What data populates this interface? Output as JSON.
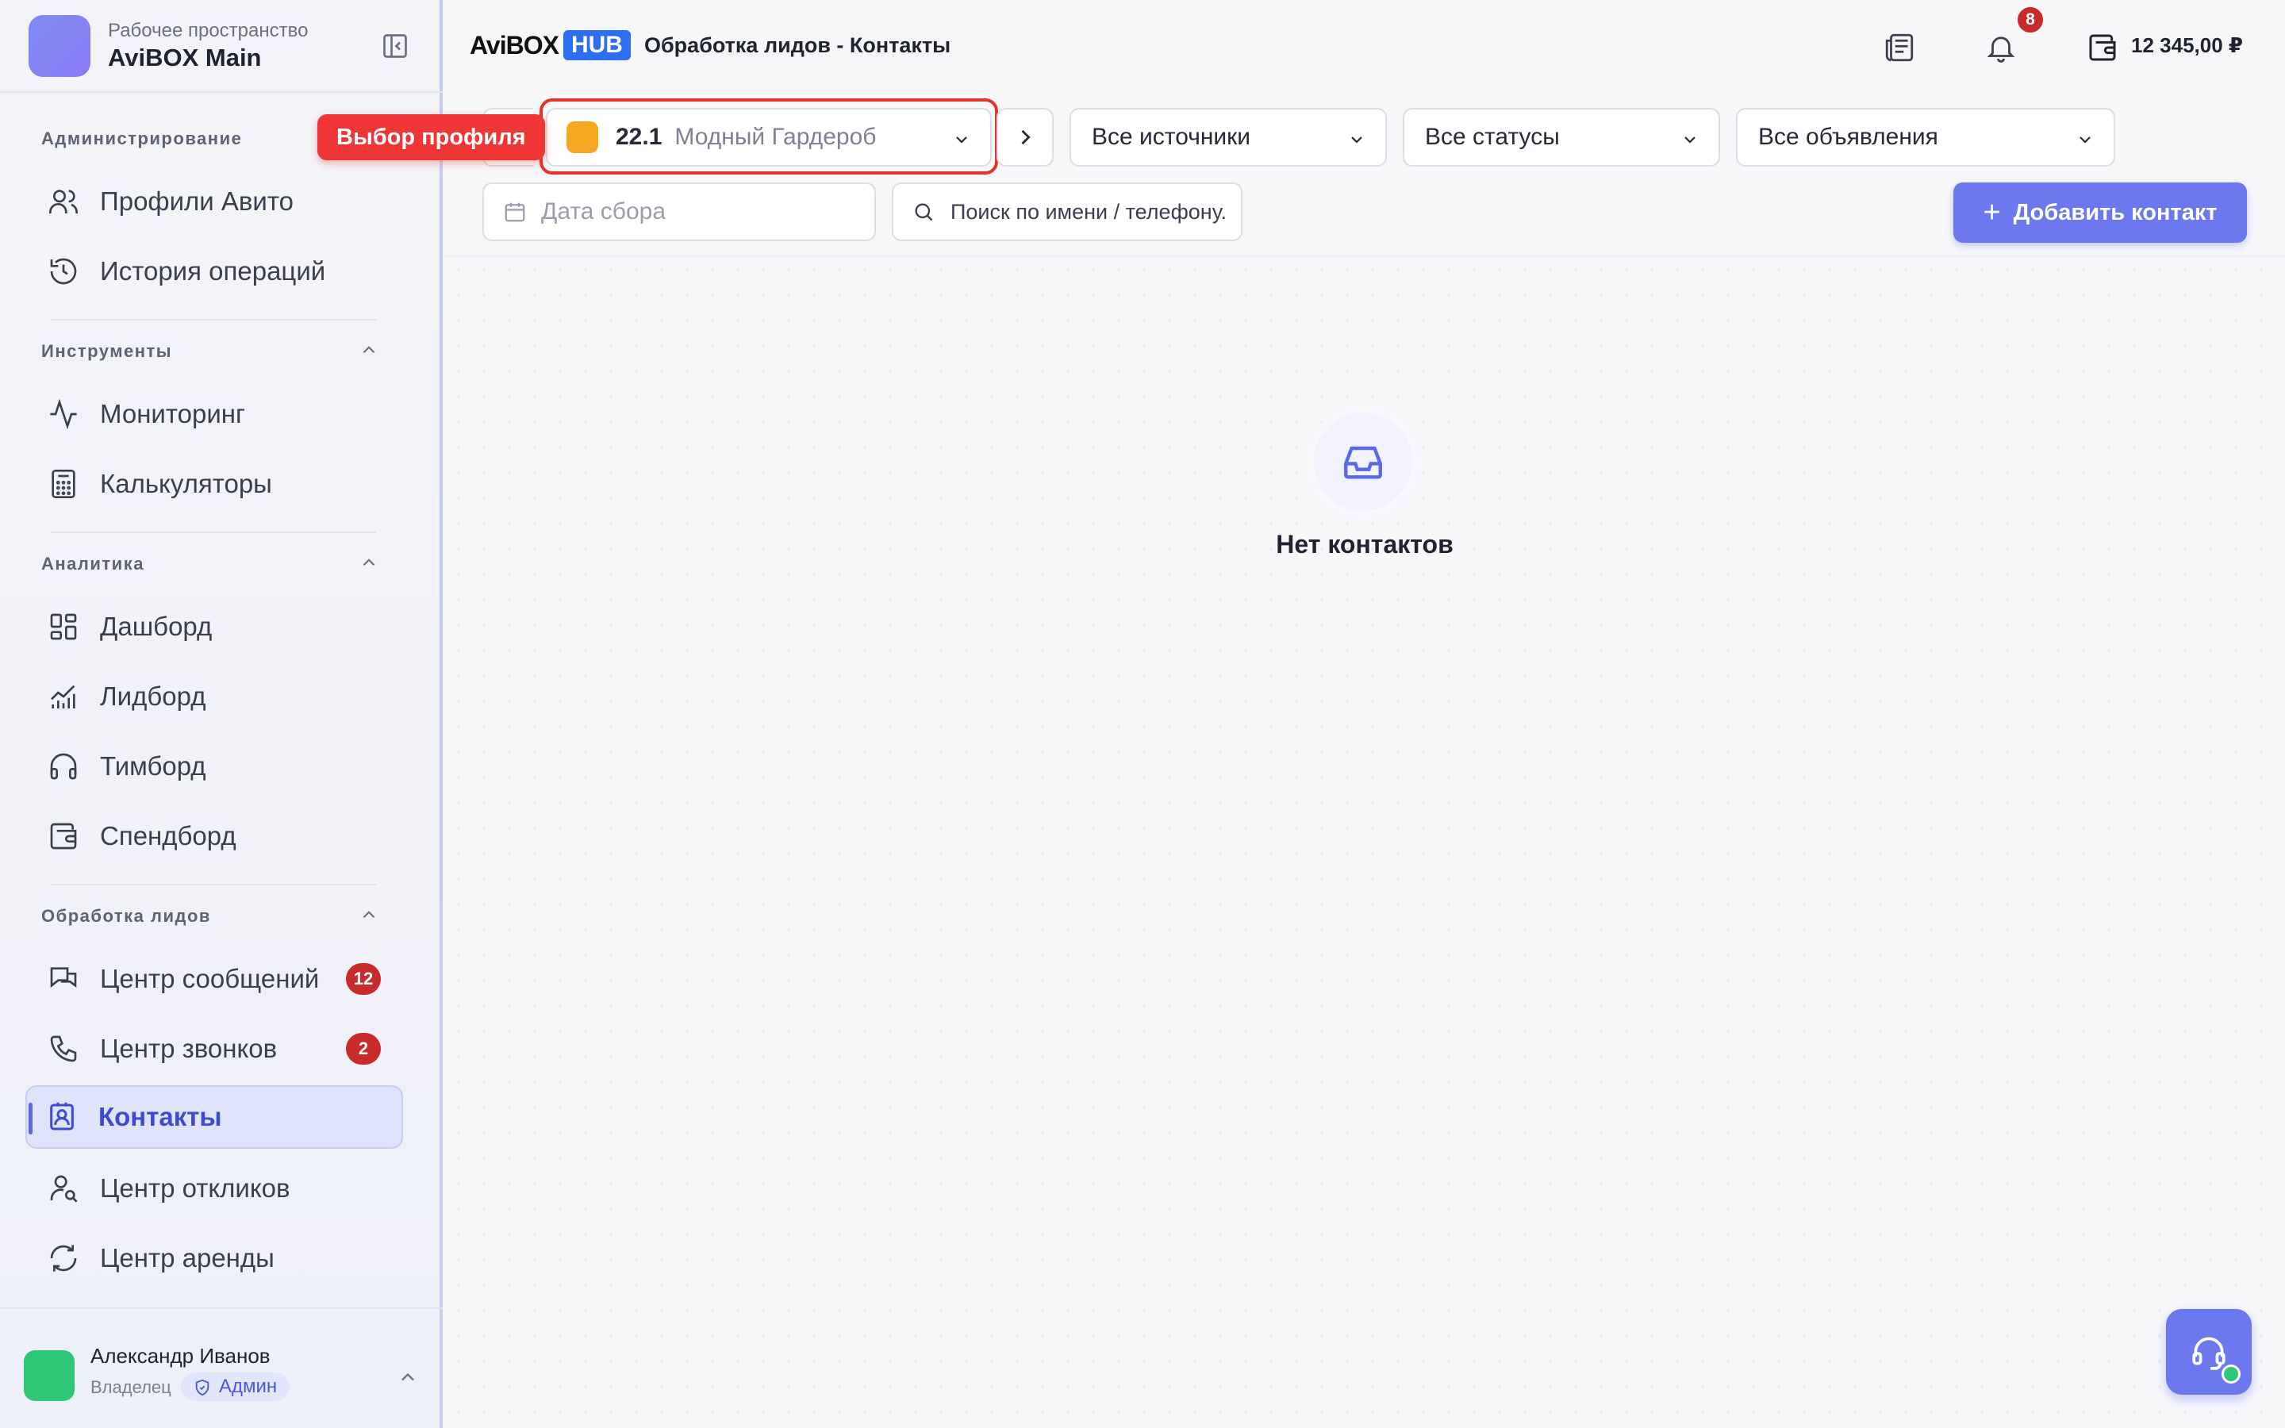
{
  "workspace": {
    "subtitle": "Рабочее пространство",
    "name": "AviBOX Main"
  },
  "sidebar": {
    "sections": {
      "admin": "Администрирование",
      "tools": "Инструменты",
      "analytics": "Аналитика",
      "leads": "Обработка лидов"
    },
    "items": {
      "avito_profiles": "Профили Авито",
      "history": "История операций",
      "monitoring": "Мониторинг",
      "calculators": "Калькуляторы",
      "dashboard": "Дашборд",
      "leadboard": "Лидборд",
      "teamboard": "Тимборд",
      "spendboard": "Спендборд",
      "messages": "Центр сообщений",
      "calls": "Центр звонков",
      "contacts": "Контакты",
      "responses": "Центр откликов",
      "rent": "Центр аренды"
    },
    "badges": {
      "messages": "12",
      "calls": "2"
    },
    "active_item": "contacts"
  },
  "user": {
    "name": "Александр Иванов",
    "role": "Владелец",
    "badge": "Админ"
  },
  "tooltip": "Выбор профиля",
  "header": {
    "brand_main": "AviBOX",
    "brand_hub": "HUB",
    "breadcrumb": "Обработка лидов - Контакты",
    "notifications_count": "8",
    "balance": "12 345,00 ₽"
  },
  "filters": {
    "profile": {
      "number": "22.1",
      "name": "Модный Гардероб",
      "color": "#f5a623"
    },
    "source": "Все источники",
    "status": "Все статусы",
    "ads": "Все объявления",
    "date_placeholder": "Дата сбора",
    "search_placeholder": "Поиск по имени / телефону."
  },
  "add_button": "Добавить контакт",
  "empty_state": "Нет контактов",
  "colors": {
    "accent": "#6b78ee",
    "danger": "#c92b2b",
    "highlight": "#e3342f",
    "online": "#2fc777"
  }
}
